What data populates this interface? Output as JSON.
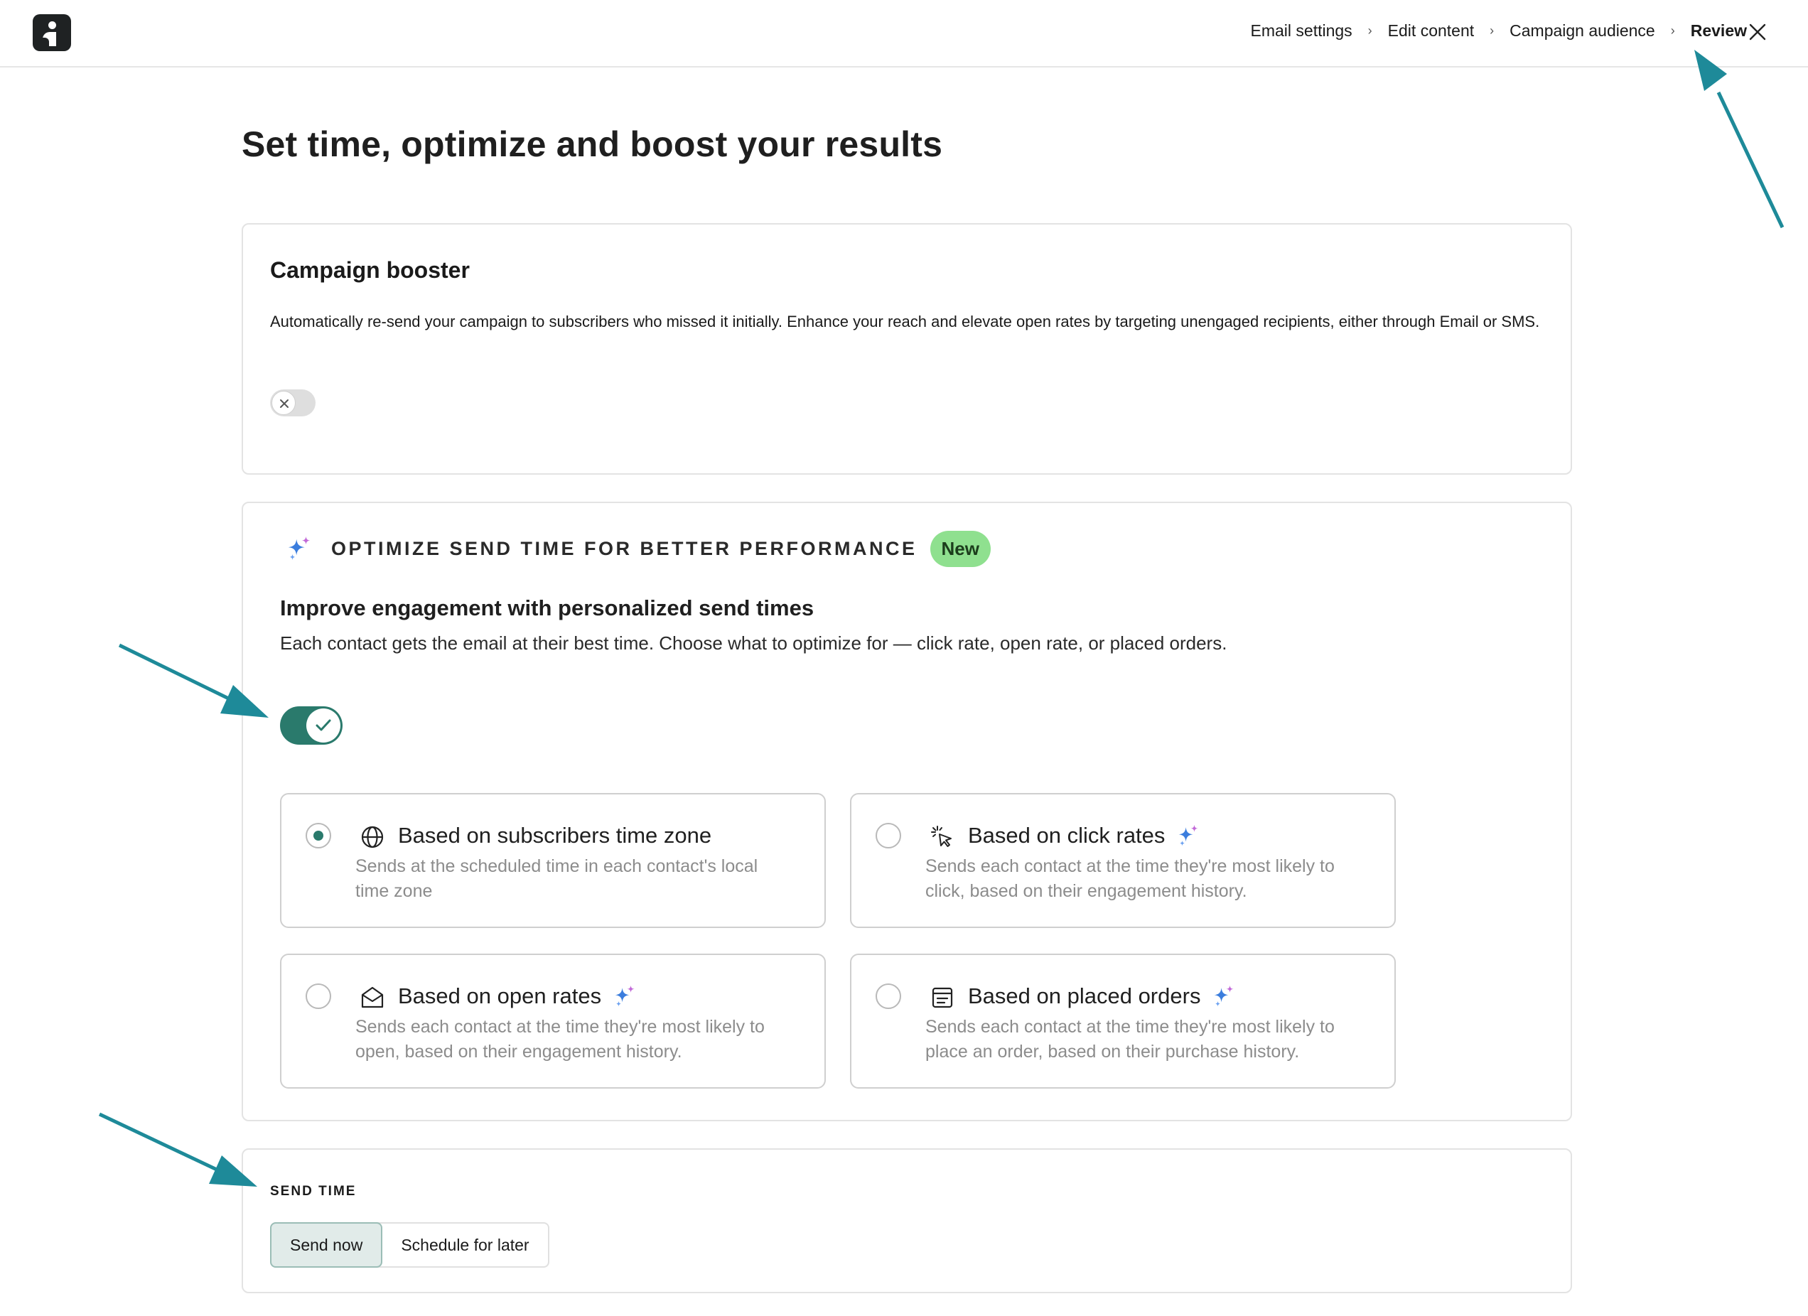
{
  "colors": {
    "accent": "#2a7a6c",
    "arrow": "#1e8a99",
    "badge": "#8fe08f",
    "sparkle_blue": "#3b7ddd",
    "sparkle_pink": "#c26ad8"
  },
  "breadcrumb": {
    "items": [
      {
        "label": "Email settings"
      },
      {
        "label": "Edit content"
      },
      {
        "label": "Campaign audience"
      },
      {
        "label": "Review"
      }
    ],
    "separator": "›"
  },
  "page": {
    "title": "Set time, optimize and boost your results"
  },
  "booster": {
    "title": "Campaign booster",
    "description": "Automatically re-send your campaign to subscribers who missed it initially. Enhance your reach and elevate open rates by targeting unengaged recipients, either through Email or SMS.",
    "enabled": false
  },
  "optimize": {
    "title": "OPTIMIZE SEND TIME FOR BETTER PERFORMANCE",
    "badge": "New",
    "subtitle": "Improve engagement with personalized send times",
    "description": "Each contact gets the email at their best time. Choose what to optimize for — click rate, open rate, or placed orders.",
    "enabled": true,
    "options": [
      {
        "label": "Based on subscribers time zone",
        "desc": "Sends at the scheduled time in each contact's local time zone",
        "icon": "globe-icon",
        "selected": true
      },
      {
        "label": "Based on click rates",
        "desc": "Sends each contact at the time they're most likely to click, based on their engagement history.",
        "icon": "cursor-click-icon",
        "selected": false
      },
      {
        "label": "Based on open rates",
        "desc": "Sends each contact at the time they're most likely to open, based on their engagement history.",
        "icon": "envelope-open-icon",
        "selected": false
      },
      {
        "label": "Based on placed orders",
        "desc": "Sends each contact at the time they're most likely to place an order, based on their purchase history.",
        "icon": "receipt-icon",
        "selected": false
      }
    ]
  },
  "send_time": {
    "label": "SEND TIME",
    "options": [
      {
        "label": "Send now",
        "selected": true
      },
      {
        "label": "Schedule for later",
        "selected": false
      }
    ]
  }
}
